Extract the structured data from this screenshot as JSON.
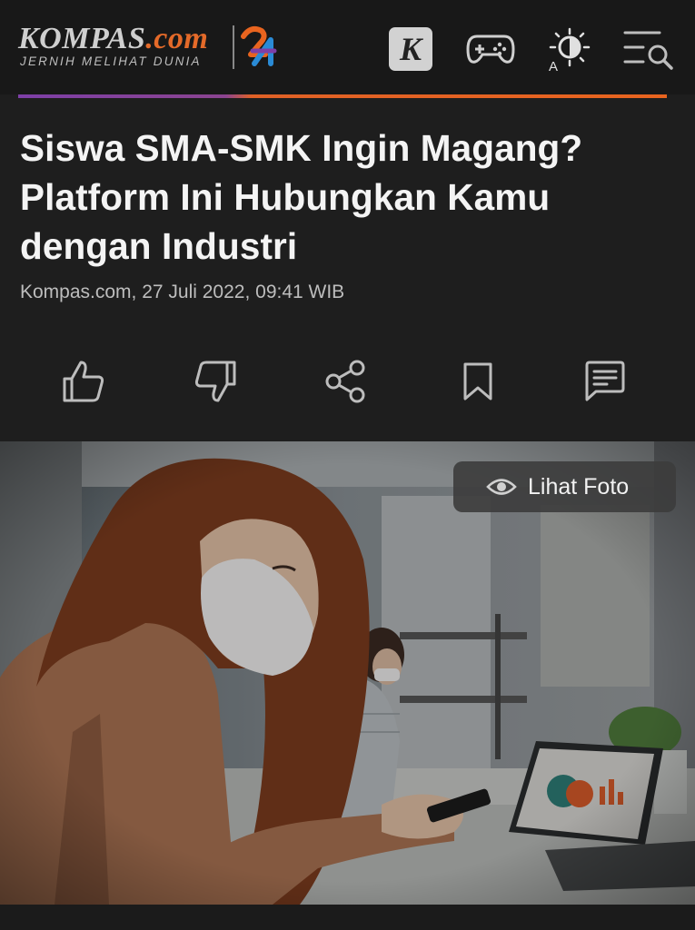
{
  "header": {
    "logo_main": "KOMPAS",
    "logo_domain": ".com",
    "logo_tagline": "JERNIH MELIHAT DUNIA",
    "k_label": "K",
    "icons": [
      "k-icon",
      "gamepad-icon",
      "theme-toggle-icon",
      "menu-search-icon"
    ],
    "accent_colors": [
      "#7d3fa7",
      "#e8641f"
    ]
  },
  "article": {
    "title": "Siswa SMA-SMK Ingin Magang? Platform Ini Hubungkan Kamu dengan Industri",
    "byline": "Kompas.com, 27 Juli 2022, 09:41 WIB"
  },
  "actions": [
    "like-icon",
    "dislike-icon",
    "share-icon",
    "bookmark-icon",
    "comment-icon"
  ],
  "photo": {
    "button_label": "Lihat Foto"
  }
}
